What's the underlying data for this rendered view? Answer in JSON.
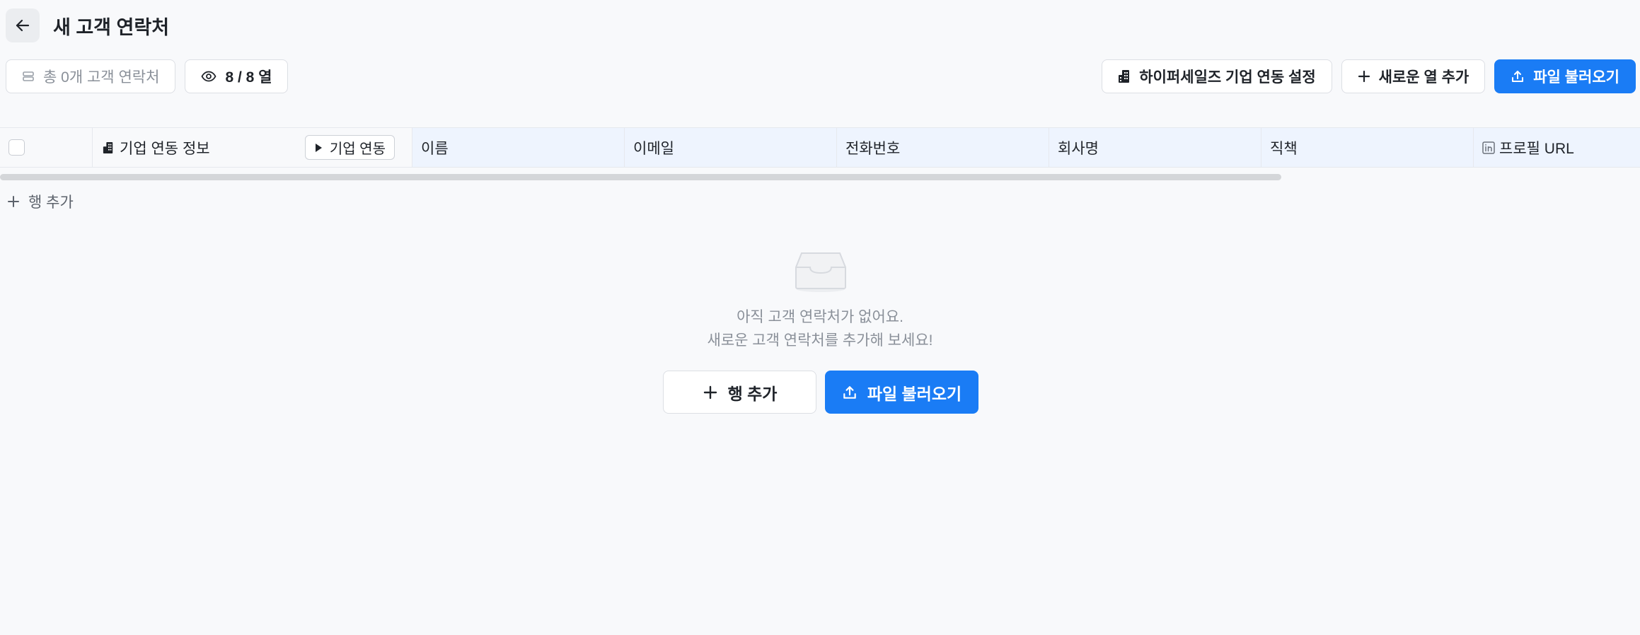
{
  "header": {
    "title": "새 고객 연락처",
    "back_icon": "arrow-left-icon"
  },
  "toolbar": {
    "count_label": "총 0개 고객 연락처",
    "columns_visible_label": "8 / 8 열",
    "company_sync_settings_label": "하이퍼세일즈 기업 연동 설정",
    "add_column_label": "새로운 열 추가",
    "import_file_label": "파일 불러오기"
  },
  "table": {
    "columns": {
      "company_sync_info": "기업 연동 정보",
      "sync_button": "기업 연동",
      "name": "이름",
      "email": "이메일",
      "phone": "전화번호",
      "company": "회사명",
      "job_title": "직책",
      "profile_url": "프로필 URL"
    },
    "add_row_label": "행 추가"
  },
  "empty_state": {
    "icon": "inbox-icon",
    "line1": "아직 고객 연락처가 없어요.",
    "line2": "새로운 고객 연락처를 추가해 보세요!",
    "add_row_label": "행 추가",
    "import_file_label": "파일 불러오기"
  },
  "colors": {
    "primary": "#1a7cf5",
    "header_bg": "#eef4fe",
    "page_bg": "#f8f9fb"
  }
}
